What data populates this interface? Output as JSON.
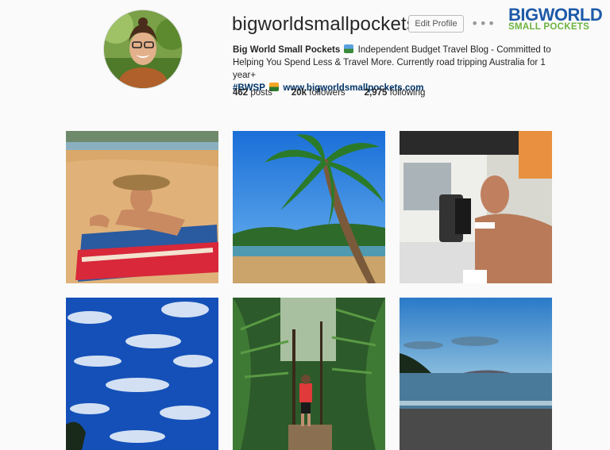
{
  "profile": {
    "username": "bigworldsmallpockets",
    "edit_label": "Edit Profile",
    "more_label": "•••",
    "bio_name": "Big World Small Pockets",
    "bio_line1": "Independent Budget Travel Blog - Committed to",
    "bio_line2": "Helping You Spend Less & Travel More. Currently road tripping Australia for 1 year+",
    "hashtag": "#BWSP",
    "website": "www.bigworldsmallpockets.com",
    "flag_emoji_icon": "landscape-emoji-icon",
    "second_emoji_icon": "sunrise-emoji-icon"
  },
  "stats": {
    "posts_count": "462",
    "posts_label": "posts",
    "followers_count": "20k",
    "followers_label": "followers",
    "following_count": "2,975",
    "following_label": "following"
  },
  "logo": {
    "line1": "BIGWORLD",
    "line2": "SMALL POCKETS"
  },
  "colors": {
    "accent_link": "#003569",
    "logo_blue": "#1e5aa8",
    "logo_green": "#6cb33f"
  },
  "photos": [
    {
      "subject": "woman-in-hat-on-australia-towel-beach"
    },
    {
      "subject": "palm-tree-tropical-beach"
    },
    {
      "subject": "man-brushing-teeth-by-4x4-mirror"
    },
    {
      "subject": "blue-sky-clouds"
    },
    {
      "subject": "rainforest-trail-hiker"
    },
    {
      "subject": "sunset-beach-island"
    }
  ]
}
